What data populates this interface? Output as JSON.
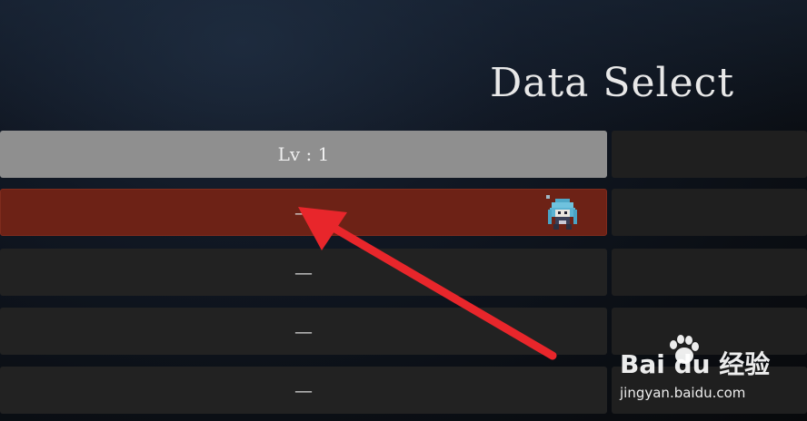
{
  "screen": {
    "title": "Data Select"
  },
  "slots": [
    {
      "label": "Lv : 1",
      "state": "filled"
    },
    {
      "label": "—",
      "state": "selected",
      "has_sprite": true,
      "sprite_icon": "character-sprite-icon"
    },
    {
      "label": "—",
      "state": "empty"
    },
    {
      "label": "—",
      "state": "empty"
    },
    {
      "label": "—",
      "state": "empty"
    }
  ],
  "annotation": {
    "arrow_icon": "red-arrow-icon",
    "color": "#e8262b"
  },
  "watermark": {
    "logo_text": "Bai du 经验",
    "url_text": "jingyan.baidu.com",
    "icon": "baidu-paw-icon"
  },
  "colors": {
    "selected_slot": "#6d2216",
    "filled_slot": "#8f8f8f",
    "empty_slot": "#222222"
  }
}
